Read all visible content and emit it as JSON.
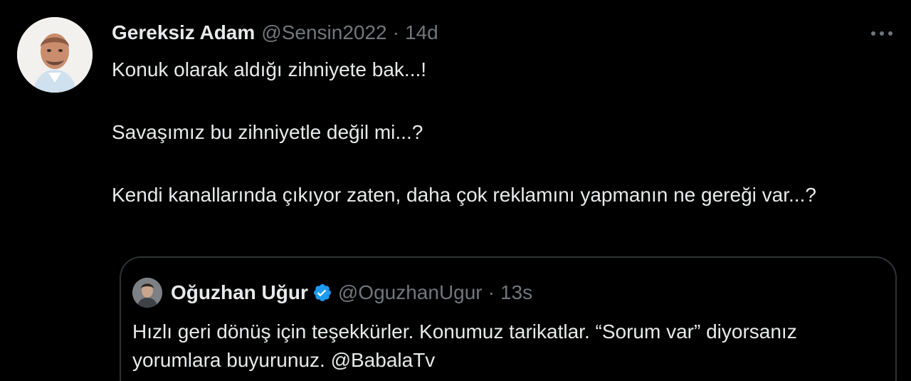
{
  "tweet": {
    "author_name": "Gereksiz Adam",
    "author_handle": "@Sensin2022",
    "separator": "·",
    "timestamp": "14d",
    "paragraphs": [
      "Konuk olarak aldığı zihniyete bak...!",
      "Savaşımız bu zihniyetle değil mi...?",
      "Kendi kanallarında çıkıyor zaten, daha çok reklamını yapmanın ne gereği var...?"
    ],
    "more_icon": "more-horizontal-icon"
  },
  "quoted_tweet": {
    "author_name": "Oğuzhan Uğur",
    "author_handle": "@OguzhanUgur",
    "separator": "·",
    "timestamp": "13s",
    "verified_icon": "verified-badge-icon",
    "text": "Hızlı geri dönüş için teşekkürler. Konumuz tarikatlar. “Sorum var” diyorsanız yorumlara buyurunuz. @BabalaTv"
  },
  "colors": {
    "background": "#000000",
    "primary_text": "#e7e9ea",
    "secondary_text": "#71767b",
    "border": "#2f3336",
    "verified": "#1d9bf0"
  }
}
